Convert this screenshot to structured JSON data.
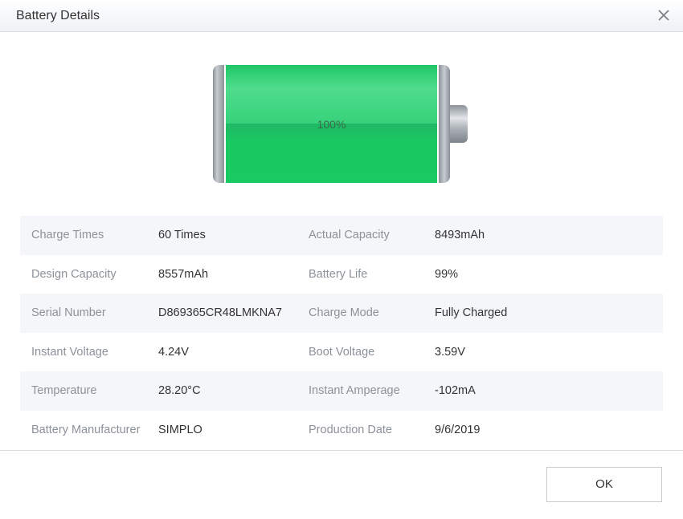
{
  "window": {
    "title": "Battery Details"
  },
  "battery": {
    "percent_label": "100%",
    "level": 1.0,
    "fill_color": "#23c96a"
  },
  "details": {
    "rows": [
      {
        "left_label": "Charge Times",
        "left_value": "60 Times",
        "right_label": "Actual Capacity",
        "right_value": "8493mAh"
      },
      {
        "left_label": "Design Capacity",
        "left_value": "8557mAh",
        "right_label": "Battery Life",
        "right_value": "99%"
      },
      {
        "left_label": "Serial Number",
        "left_value": "D869365CR48LMKNA7",
        "right_label": "Charge Mode",
        "right_value": "Fully Charged"
      },
      {
        "left_label": "Instant Voltage",
        "left_value": "4.24V",
        "right_label": "Boot Voltage",
        "right_value": "3.59V"
      },
      {
        "left_label": "Temperature",
        "left_value": "28.20°C",
        "right_label": "Instant Amperage",
        "right_value": "-102mA"
      },
      {
        "left_label": "Battery Manufacturer",
        "left_value": "SIMPLO",
        "right_label": "Production Date",
        "right_value": "9/6/2019"
      }
    ]
  },
  "footer": {
    "ok_label": "OK"
  },
  "icons": {
    "close": "close-icon"
  }
}
